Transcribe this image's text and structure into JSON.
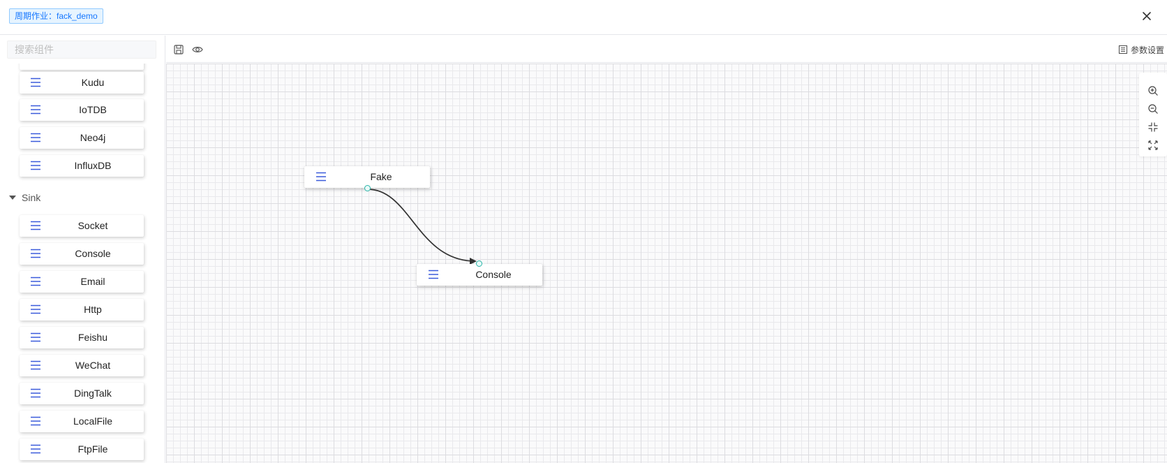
{
  "header": {
    "job_tag": "周期作业：fack_demo",
    "close_icon": "close-icon"
  },
  "sidebar": {
    "search_placeholder": "搜索组件",
    "components_before": [
      {
        "label": "Kudu"
      },
      {
        "label": "IoTDB"
      },
      {
        "label": "Neo4j"
      },
      {
        "label": "InfluxDB"
      }
    ],
    "sink_group": {
      "label": "Sink",
      "items": [
        {
          "label": "Socket"
        },
        {
          "label": "Console"
        },
        {
          "label": "Email"
        },
        {
          "label": "Http"
        },
        {
          "label": "Feishu"
        },
        {
          "label": "WeChat"
        },
        {
          "label": "DingTalk"
        },
        {
          "label": "LocalFile"
        },
        {
          "label": "FtpFile"
        }
      ]
    }
  },
  "toolbar": {
    "save_icon": "save-icon",
    "preview_icon": "eye-icon",
    "params_label": "参数设置"
  },
  "canvas": {
    "nodes": [
      {
        "id": "fake",
        "label": "Fake"
      },
      {
        "id": "console",
        "label": "Console"
      }
    ],
    "edges": [
      {
        "from": "fake",
        "to": "console"
      }
    ],
    "controls": [
      "zoom-in-icon",
      "zoom-out-icon",
      "fit-view-icon",
      "fullscreen-icon"
    ]
  },
  "colors": {
    "accent": "#1677ff",
    "node_icon": "#3b5bdb",
    "port": "#2bb4a8"
  }
}
